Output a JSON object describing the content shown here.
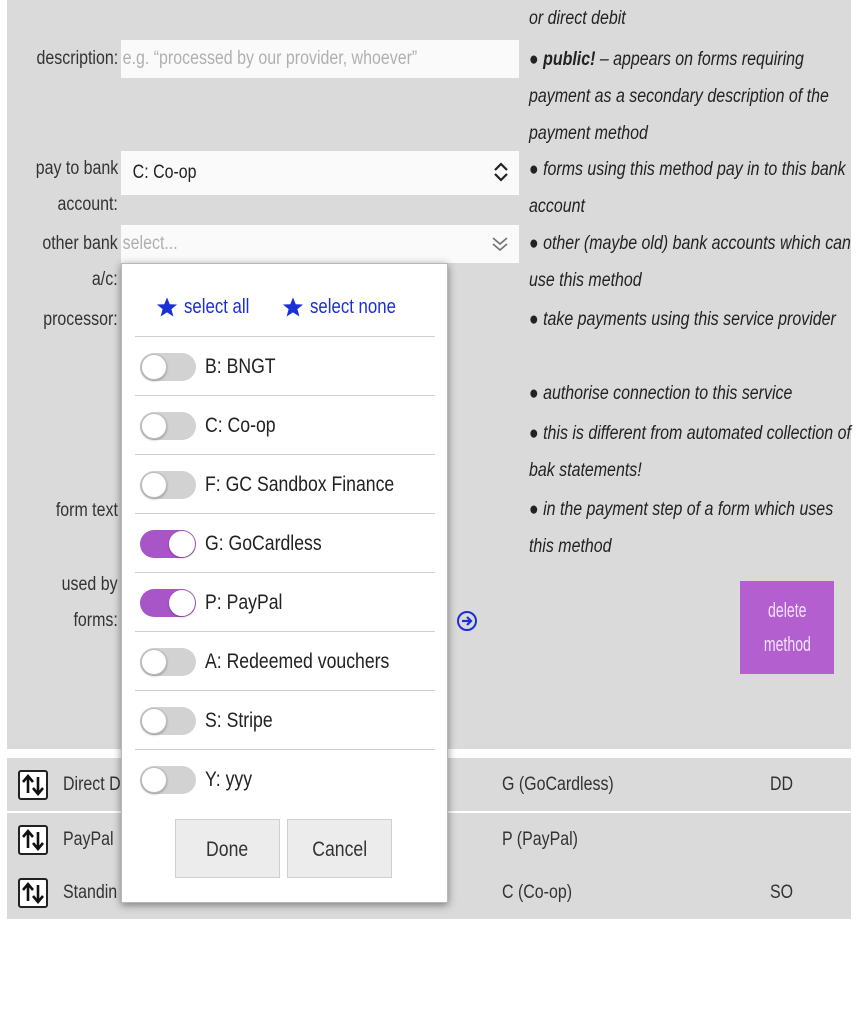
{
  "form": {
    "note_top": "or direct debit",
    "description": {
      "label": "description:",
      "placeholder": "e.g. “processed by our provider, whoever”",
      "note_bold": "public!",
      "note_rest": " – appears on forms requiring payment as a secondary description of the payment method"
    },
    "pay_to_bank": {
      "label_line1": "pay to bank",
      "label_line2": "account:",
      "value": "C: Co-op",
      "note": "forms using this method pay in to this bank account"
    },
    "other_bank": {
      "label_line1": "other bank",
      "label_line2": "a/c:",
      "placeholder": "select...",
      "note": "other (maybe old) bank accounts which can use this method"
    },
    "processor": {
      "label": "processor:",
      "note1": "take payments using this service provider",
      "note2": "authorise connection to this service",
      "note3": "this is different from automated collection of bak statements!"
    },
    "form_text": {
      "label": "form text",
      "note": "in the payment step of a form which uses this method"
    },
    "used_by": {
      "label_line1": "used by",
      "label_line2": "forms:"
    },
    "bullet": "●",
    "delete_button": {
      "line1": "delete",
      "line2": "method"
    }
  },
  "methods_table": [
    {
      "name": "Direct D",
      "processor": "G (GoCardless)",
      "code": "DD"
    },
    {
      "name": "PayPal",
      "processor": "P (PayPal)",
      "code": ""
    },
    {
      "name": "Standin",
      "processor": "C (Co-op)",
      "code": "SO"
    }
  ],
  "popup": {
    "select_all": "select all",
    "select_none": "select none",
    "options": [
      {
        "label": "B: BNGT",
        "checked": false
      },
      {
        "label": "C: Co-op",
        "checked": false
      },
      {
        "label": "F: GC Sandbox Finance",
        "checked": false
      },
      {
        "label": "G: GoCardless",
        "checked": true
      },
      {
        "label": "P: PayPal",
        "checked": true
      },
      {
        "label": "A: Redeemed vouchers",
        "checked": false
      },
      {
        "label": "S: Stripe",
        "checked": false
      },
      {
        "label": "Y: yyy",
        "checked": false
      }
    ],
    "done": "Done",
    "cancel": "Cancel"
  },
  "colors": {
    "panel_bg": "#dadada",
    "accent": "#b35fd0",
    "toggle_on": "#a855c7",
    "link_blue": "#1a2fd6"
  }
}
